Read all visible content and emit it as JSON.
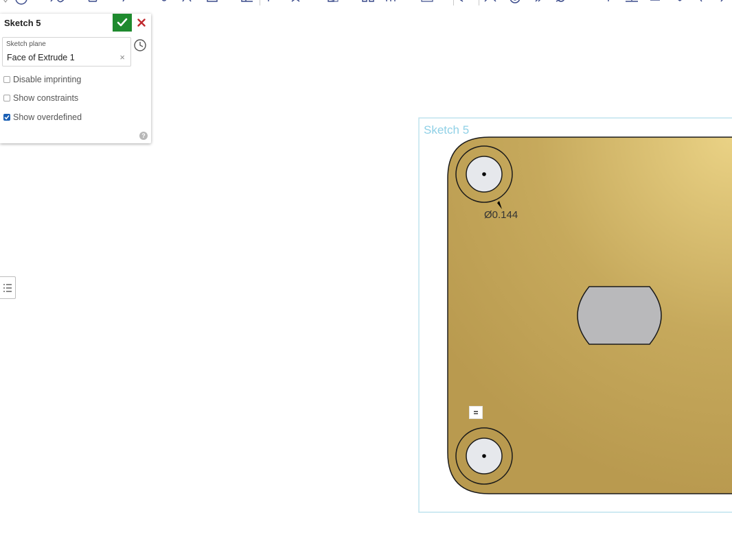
{
  "dialog": {
    "title": "Sketch 5",
    "sketch_plane_label": "Sketch plane",
    "sketch_plane_value": "Face of Extrude 1",
    "clear_glyph": "×",
    "options": [
      {
        "label": "Disable imprinting",
        "checked": false
      },
      {
        "label": "Show constraints",
        "checked": false
      },
      {
        "label": "Show overdefined",
        "checked": true
      }
    ],
    "help_glyph": "?"
  },
  "canvas": {
    "sketch_name": "Sketch 5",
    "diameter_dimension": "Ø0.144",
    "equal_constraint": "=",
    "colors": {
      "part_face": "#c2a457",
      "part_face_highlight": "#e8cf82",
      "sketch_frame": "#bfe3ee",
      "sketch_label": "#8fd0e6",
      "hole_fill": "#e6e8ec",
      "slot_fill": "#b9b9bb"
    }
  },
  "icons": {
    "ok": "check-icon",
    "cancel": "close-icon",
    "history": "clock-history-icon",
    "help": "help-circle-icon",
    "list": "list-icon"
  }
}
